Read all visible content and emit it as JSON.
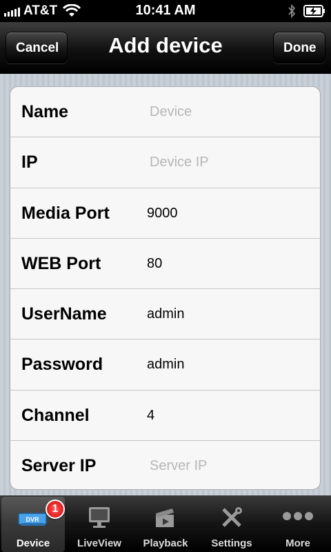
{
  "status_bar": {
    "carrier": "AT&T",
    "time": "10:41 AM",
    "icons": [
      "signal-icon",
      "wifi-icon",
      "bluetooth-icon",
      "battery-charging-icon"
    ]
  },
  "nav": {
    "title": "Add device",
    "cancel_label": "Cancel",
    "done_label": "Done"
  },
  "form": {
    "rows": [
      {
        "label": "Name",
        "value": "",
        "placeholder": "Device"
      },
      {
        "label": "IP",
        "value": "",
        "placeholder": "Device IP"
      },
      {
        "label": "Media Port",
        "value": "9000",
        "placeholder": ""
      },
      {
        "label": "WEB Port",
        "value": "80",
        "placeholder": ""
      },
      {
        "label": "UserName",
        "value": "admin",
        "placeholder": ""
      },
      {
        "label": "Password",
        "value": "admin",
        "placeholder": ""
      },
      {
        "label": "Channel",
        "value": "4",
        "placeholder": ""
      },
      {
        "label": "Server IP",
        "value": "",
        "placeholder": "Server IP"
      }
    ]
  },
  "tabs": [
    {
      "label": "Device",
      "icon": "dvr-icon",
      "badge": "1",
      "active": true
    },
    {
      "label": "LiveView",
      "icon": "monitor-icon"
    },
    {
      "label": "Playback",
      "icon": "clapperboard-icon"
    },
    {
      "label": "Settings",
      "icon": "tools-icon"
    },
    {
      "label": "More",
      "icon": "more-dots-icon"
    }
  ],
  "colors": {
    "badge": "#d10000",
    "placeholder_text": "#b6b6b6"
  }
}
